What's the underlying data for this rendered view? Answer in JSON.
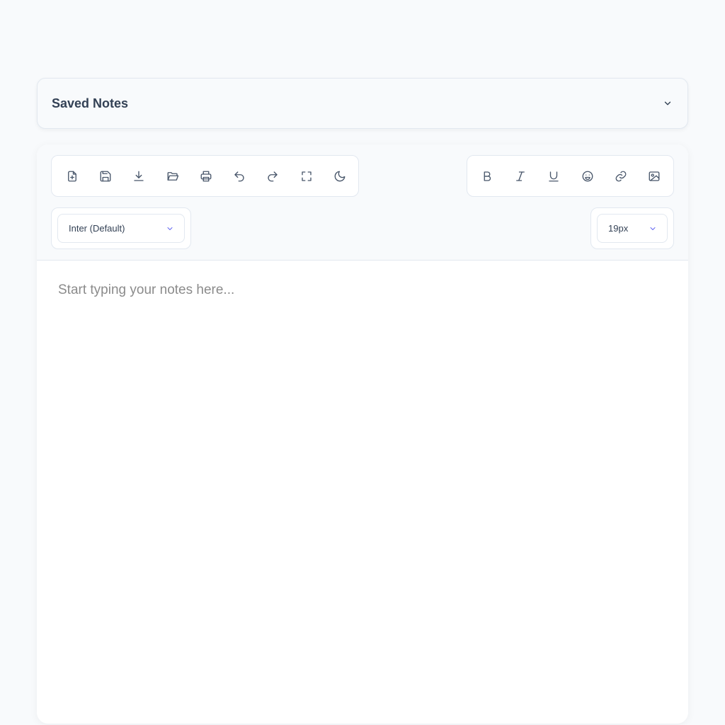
{
  "saved_notes": {
    "title": "Saved Notes",
    "icon": "chevron-down-icon"
  },
  "toolbar": {
    "file_tools": [
      {
        "name": "new-note-button",
        "icon": "file-plus-icon"
      },
      {
        "name": "save-button",
        "icon": "floppy-disk-icon"
      },
      {
        "name": "download-button",
        "icon": "download-icon"
      },
      {
        "name": "open-button",
        "icon": "folder-open-icon"
      },
      {
        "name": "print-button",
        "icon": "printer-icon"
      },
      {
        "name": "undo-button",
        "icon": "undo-icon"
      },
      {
        "name": "redo-button",
        "icon": "redo-icon"
      },
      {
        "name": "fullscreen-button",
        "icon": "expand-icon"
      },
      {
        "name": "dark-mode-button",
        "icon": "moon-icon"
      }
    ],
    "format_tools": [
      {
        "name": "bold-button",
        "icon": "bold-icon"
      },
      {
        "name": "italic-button",
        "icon": "italic-icon"
      },
      {
        "name": "underline-button",
        "icon": "underline-icon"
      },
      {
        "name": "emoji-button",
        "icon": "smiley-icon"
      },
      {
        "name": "link-button",
        "icon": "link-icon"
      },
      {
        "name": "image-button",
        "icon": "image-icon"
      }
    ]
  },
  "font_select": {
    "value": "Inter (Default)"
  },
  "size_select": {
    "value": "19px"
  },
  "editor": {
    "placeholder": "Start typing your notes here..."
  },
  "colors": {
    "accent": "#6366f1",
    "background": "#f8fafc",
    "border": "#e2e8f0",
    "icon": "#475569"
  }
}
